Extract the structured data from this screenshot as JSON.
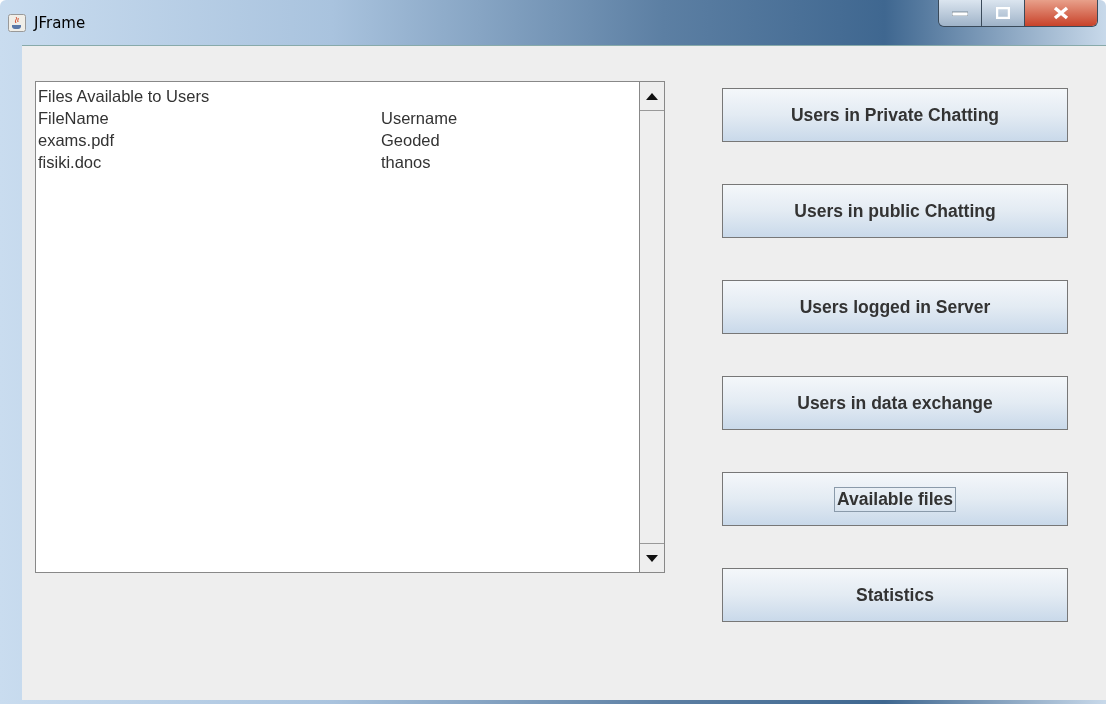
{
  "window": {
    "title": "JFrame"
  },
  "text_area": {
    "heading": "Files Available to Users",
    "rows": [
      {
        "file": "FileName",
        "user": "Username"
      },
      {
        "file": "exams.pdf",
        "user": "Geoded"
      },
      {
        "file": "fisiki.doc",
        "user": "thanos"
      }
    ]
  },
  "buttons": [
    {
      "label": "Users in Private Chatting",
      "focused": false
    },
    {
      "label": "Users in public Chatting",
      "focused": false
    },
    {
      "label": "Users logged in Server",
      "focused": false
    },
    {
      "label": "Users in data exchange",
      "focused": false
    },
    {
      "label": "Available files",
      "focused": true
    },
    {
      "label": "Statistics",
      "focused": false
    }
  ]
}
